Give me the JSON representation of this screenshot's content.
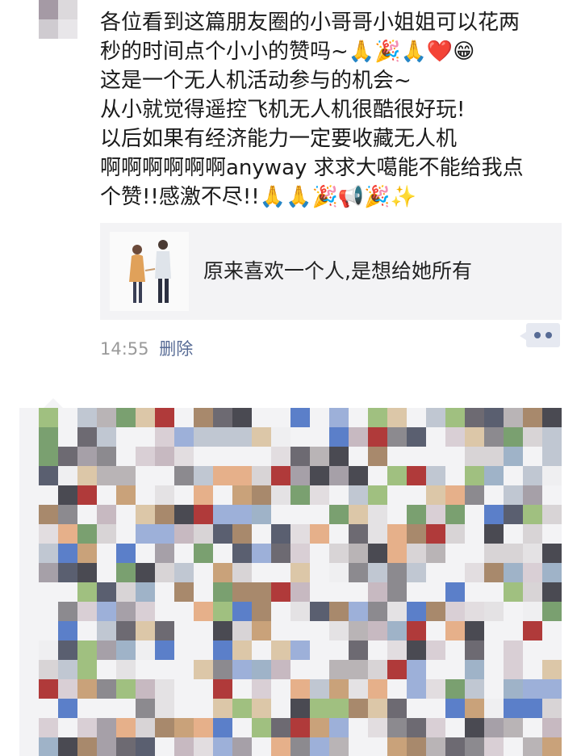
{
  "post": {
    "lines": [
      "各位看到这篇朋友圈的小哥哥小姐姐可以花两",
      "秒的时间点个小小的赞吗~🙏🎉🙏❤️😁",
      "这是一个无人机活动参与的机会~",
      "从小就觉得遥控飞机无人机很酷很好玩!",
      "以后如果有经济能力一定要收藏无人机",
      "啊啊啊啊啊啊anyway 求求大噶能不能给我点",
      "个赞!!感激不尽!!🙏🙏🎉📢🎉✨"
    ]
  },
  "link_card": {
    "title": "原来喜欢一个人,是想给她所有"
  },
  "meta": {
    "time": "14:55",
    "delete": "删除"
  },
  "colors": {
    "link_blue": "#576b95",
    "card_bg": "#f3f3f5"
  }
}
